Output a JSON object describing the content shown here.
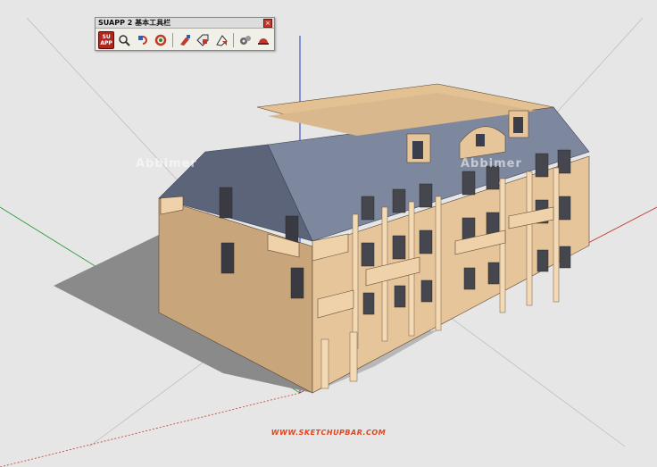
{
  "toolbar": {
    "title": "SUAPP 2 基本工具栏",
    "close_glyph": "×",
    "logo_top": "SU",
    "logo_bottom": "APP",
    "icons": [
      "magnifier-icon",
      "rotate-icon",
      "refresh-icon",
      "brush-icon",
      "tag-icon",
      "flag-icon",
      "gears-icon",
      "helmet-icon"
    ]
  },
  "watermarks": [
    "Abbimer",
    "Abbimer"
  ],
  "footer": {
    "url": "WWW.SKETCHUPBAR.COM"
  },
  "colors": {
    "background": "#e6e6e6",
    "facade": "#e7c59a",
    "facade_shade": "#c9a57c",
    "roof": "#7d889f",
    "roof_dark": "#5b6479",
    "ground_shadow": "#8a8a8a",
    "axis_red": "#c0392b",
    "axis_green": "#2e9a3a",
    "axis_blue": "#2338c4",
    "footer_text": "#e0451c"
  }
}
